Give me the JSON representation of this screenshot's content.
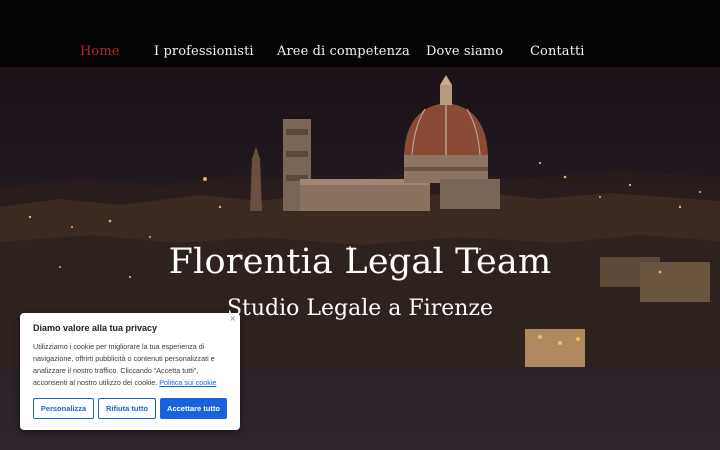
{
  "nav": {
    "items": [
      {
        "label": "Home",
        "active": true
      },
      {
        "label": "I professionisti",
        "active": false
      },
      {
        "label": "Aree di competenza",
        "active": false
      },
      {
        "label": "Dove siamo",
        "active": false
      },
      {
        "label": "Contatti",
        "active": false
      }
    ]
  },
  "hero": {
    "title": "Florentia Legal Team",
    "subtitle": "Studio Legale a Firenze"
  },
  "cookie_banner": {
    "title": "Diamo valore alla tua privacy",
    "text": "Utilizziamo i cookie per migliorare la tua esperienza di navigazione, offrirti pubblicità o contenuti personalizzati e analizzare il nostro traffico. Cliccando “Accetta tutti”, acconsenti al nostro utilizzo dei cookie.",
    "policy_link": "Politica sui cookie",
    "close_symbol": "×",
    "buttons": {
      "customize": "Personalizza",
      "reject": "Rifiuta tutto",
      "accept": "Accettare tutto"
    }
  },
  "colors": {
    "active_nav": "#b2262a",
    "accent_blue": "#1863dc"
  }
}
